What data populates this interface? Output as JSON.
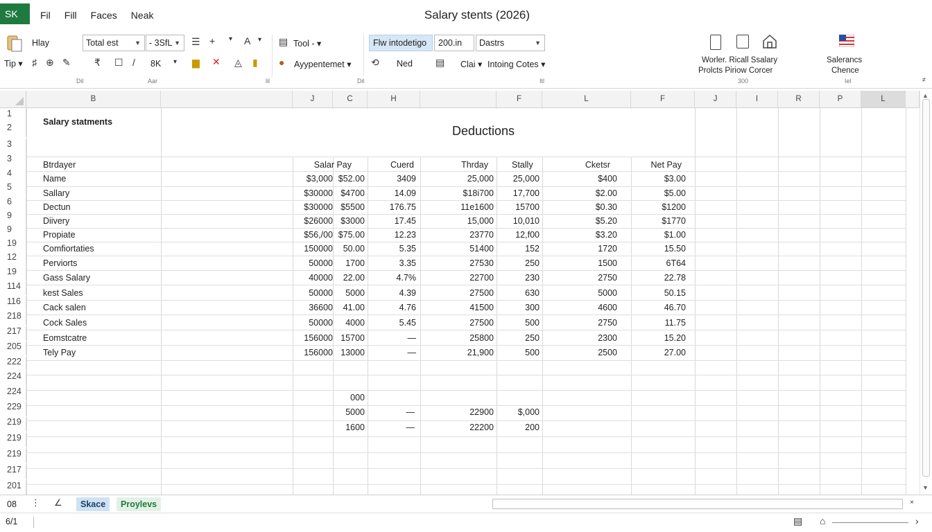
{
  "titlebar": {
    "app_badge": "SK",
    "menu": [
      "Fil",
      "Fill",
      "Faces",
      "Neak"
    ],
    "title": "Salary stents (2026)"
  },
  "ribbon": {
    "row1": {
      "paste_label": "Hlay",
      "font_name": "Total est",
      "font_size": "- 3SfL",
      "tool_label": "Tool -",
      "name_box": "Flw intodetigo",
      "zoom_value": "200.in",
      "dates_label": "Dastrs"
    },
    "row2": {
      "tip_label": "Tip",
      "font_size_small": "8K",
      "appointment_label": "Ayypentemet",
      "ned_label": "Ned",
      "clear_label": "Clai",
      "intoing_label": "Intoing Cotes"
    },
    "group_labels": [
      "Dil",
      "Aar",
      "lil",
      "Dil",
      "Itl"
    ],
    "right_group": {
      "label_line1": "Worler. Ricall Ssalary",
      "label_line2": "Prolcts Piriow Corcer",
      "sub": "300",
      "flag_line1": "Salerancs",
      "flag_line2": "Chence",
      "flag_sub": "Iel"
    }
  },
  "grid": {
    "columns": [
      "B",
      "J",
      "C",
      "H",
      "F",
      "L",
      "F",
      "J",
      "I",
      "R",
      "P",
      "L"
    ],
    "row_numbers": [
      "1",
      "2",
      "3",
      "3",
      "4",
      "5",
      "6",
      "9",
      "9",
      "19",
      "12",
      "19",
      "114",
      "116",
      "218",
      "217",
      "205",
      "222",
      "224",
      "224",
      "229",
      "219",
      "219",
      "219",
      "217",
      "201"
    ],
    "title_cell": "Salary statments",
    "deductions_label": "Deductions",
    "headers": [
      "Btrdayer",
      "Salar Pay",
      "Cuerd",
      "Thrday",
      "Stally",
      "Cketsr",
      "Net Pay"
    ],
    "rows": [
      [
        "Name",
        "$3,000",
        "$52.00",
        "3409",
        "25,000",
        "25,000",
        "$400",
        "$3.00"
      ],
      [
        "Sallary",
        "$30000",
        "$4700",
        "14.09",
        "$18i700",
        "17,700",
        "$2.00",
        "$5.00"
      ],
      [
        "Dectun",
        "$30000",
        "$5500",
        "176.75",
        "11e1600",
        "15700",
        "$0.30",
        "$1200"
      ],
      [
        "Diivery",
        "$26000",
        "$3000",
        "17.45",
        "15,000",
        "10,010",
        "$5.20",
        "$1770"
      ],
      [
        "Propiate",
        "$56,/00",
        "$75.00",
        "12.23",
        "23770",
        "12,f00",
        "$3.20",
        "$1.00"
      ],
      [
        "Comfiortaties",
        "150000",
        "50.00",
        "5.35",
        "51400",
        "152",
        "1720",
        "15.50"
      ],
      [
        "Perviorts",
        "50000",
        "1700",
        "3.35",
        "27530",
        "250",
        "1500",
        "6T64"
      ],
      [
        "Gass Salary",
        "40000",
        "22.00",
        "4.7%",
        "22700",
        "230",
        "2750",
        "22.78"
      ],
      [
        "kest Sales",
        "50000",
        "5000",
        "4.39",
        "27500",
        "630",
        "5000",
        "50.15"
      ],
      [
        "Cack salen",
        "36600",
        "41.00",
        "4.76",
        "41500",
        "300",
        "4600",
        "46.70"
      ],
      [
        "Cock Sales",
        "50000",
        "4000",
        "5.45",
        "27500",
        "500",
        "2750",
        "11.75"
      ],
      [
        "Eomstcatre",
        "156000",
        "15700",
        "—",
        "25800",
        "250",
        "2300",
        "15.20"
      ],
      [
        "Tely Pay",
        "156000",
        "13000",
        "—",
        "21,900",
        "500",
        "2500",
        "27.00"
      ]
    ],
    "extra": {
      "r1_c": "000",
      "r2_c": "5000",
      "r2_h": "—",
      "r2_t": "22900",
      "r2_s": "$,000",
      "r3_c": "1600",
      "r3_h": "—",
      "r3_t": "22200",
      "r3_s": "200"
    }
  },
  "sheets": {
    "left_num": "08",
    "tabs": [
      "Skace",
      "Proylevs"
    ]
  },
  "status": {
    "page": "6/1"
  },
  "colors": {
    "excel_green": "#1e7a3e",
    "active_tab": "#cfe2f3",
    "name_box_highlight": "#d6e7f6"
  }
}
